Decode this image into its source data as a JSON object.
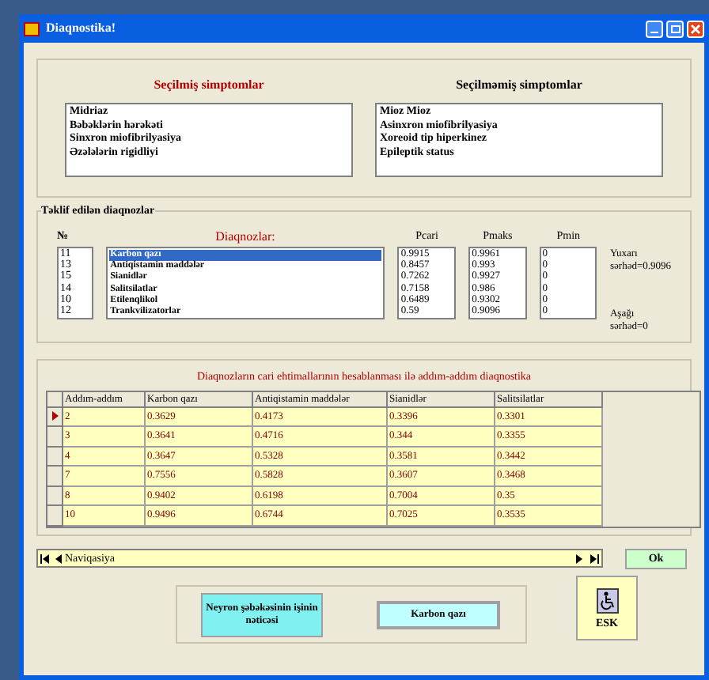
{
  "window": {
    "title": "Diaqnostika!"
  },
  "symptoms": {
    "selected_title": "Seçilmiş simptomlar",
    "selected": [
      "Midriaz",
      "Bəbəklərin hərəkəti",
      "Sinxron miofibrilyasiya",
      "Əzələlərin rigidliyi"
    ],
    "unselected_title": "Seçilməmiş simptomlar",
    "unselected": [
      "Mioz Mioz",
      "Asinxron miofibrilyasiya",
      "Xoreoid tip hiperkinez",
      "Epileptik status"
    ]
  },
  "diagnoses": {
    "group_label": "Təklif edilən diaqnozlar",
    "columns": [
      "№",
      "Diaqnozlar:",
      "Pcari",
      "Pmaks",
      "Pmin"
    ],
    "rows": [
      {
        "no": "11",
        "name": "Karbon qazı",
        "pcari": "0.9915",
        "pmaks": "0.9961",
        "pmin": "0",
        "selected": true
      },
      {
        "no": "13",
        "name": "Antiqistamin maddələr",
        "pcari": "0.8457",
        "pmaks": "0.993",
        "pmin": "0",
        "selected": false
      },
      {
        "no": "15",
        "name": "Sianidlər",
        "pcari": "0.7262",
        "pmaks": "0.9927",
        "pmin": "0",
        "selected": false
      },
      {
        "no": "14",
        "name": "Salitsilatlar",
        "pcari": "0.7158",
        "pmaks": "0.986",
        "pmin": "0",
        "selected": false
      },
      {
        "no": "10",
        "name": "Etilenqlikol",
        "pcari": "0.6489",
        "pmaks": "0.9302",
        "pmin": "0",
        "selected": false
      },
      {
        "no": "12",
        "name": "Trankvilizatorlar",
        "pcari": "0.59",
        "pmaks": "0.9096",
        "pmin": "0",
        "selected": false
      }
    ],
    "upper": [
      "Yuxarı",
      "sərhəd=0.9096"
    ],
    "lower": [
      "Aşağı",
      "sərhəd=0"
    ]
  },
  "steps": {
    "title": "Diaqnozların cari ehtimallarının hesablanması ilə addım-addım diaqnostika",
    "columns": [
      "Addım-addım",
      "Karbon qazı",
      "Antiqistamin maddələr",
      "Sianidlər",
      "Salitsilatlar"
    ],
    "rows": [
      {
        "cells": [
          "2",
          "0.3629",
          "0.4173",
          "0.3396",
          "0.3301"
        ],
        "selected": true
      },
      {
        "cells": [
          "3",
          "0.3641",
          "0.4716",
          "0.344",
          "0.3355"
        ],
        "selected": false
      },
      {
        "cells": [
          "4",
          "0.3647",
          "0.5328",
          "0.3581",
          "0.3442"
        ],
        "selected": false
      },
      {
        "cells": [
          "7",
          "0.7556",
          "0.5828",
          "0.3607",
          "0.3468"
        ],
        "selected": false
      },
      {
        "cells": [
          "8",
          "0.9402",
          "0.6198",
          "0.7004",
          "0.35"
        ],
        "selected": false
      },
      {
        "cells": [
          "10",
          "0.9496",
          "0.6744",
          "0.7025",
          "0.3535"
        ],
        "selected": false
      }
    ]
  },
  "navigator": {
    "label": "Naviqasiya"
  },
  "ok_button": "Ok",
  "result": {
    "caption": "Neyron şəbəkəsinin işinin nəticəsi",
    "value": "Karbon qazı"
  },
  "esc_button": "ESK"
}
